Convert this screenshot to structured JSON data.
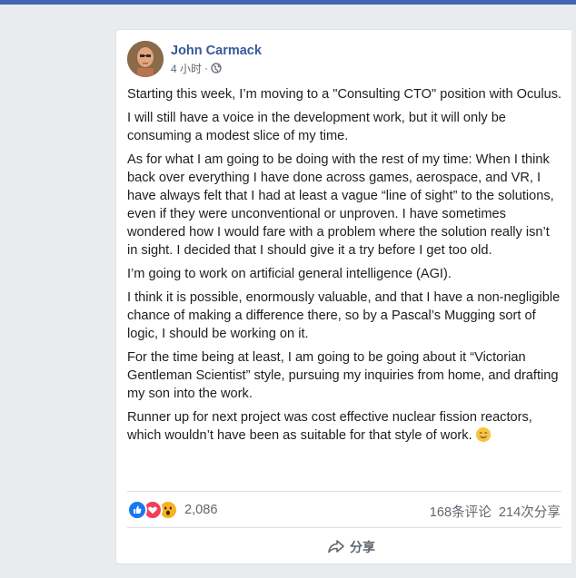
{
  "post": {
    "author": "John Carmack",
    "timestamp": "4 小时",
    "separator": "·",
    "privacy_icon": "globe-icon",
    "paragraphs": [
      "Starting this week, I’m moving to a \"Consulting CTO\" position with Oculus.",
      "I will still have a voice in the development work, but it will only be consuming a modest slice of my time.",
      "As for what I am going to be doing with the rest of my time: When I think back over everything I have done across games, aerospace, and VR, I have always felt that I had at least a vague “line of sight” to the solutions, even if they were unconventional or unproven. I have sometimes wondered how I would fare with a problem where the solution really isn’t in sight. I decided that I should give it a try before I get too old.",
      "I’m going to work on artificial general intelligence (AGI).",
      "I think it is possible, enormously valuable, and that I have a non-negligible chance of making a difference there, so by a Pascal’s Mugging sort of logic, I should be working on it.",
      "For the time being at least, I am going to be going about it “Victorian Gentleman Scientist” style, pursuing my inquiries from home, and drafting my son into the work."
    ],
    "last_paragraph": "Runner up for next project was cost effective nuclear fission reactors, which wouldn’t have been as suitable for that style of work.",
    "last_emoji": "smiling-face-icon"
  },
  "reactions": {
    "icons": [
      "like-icon",
      "love-icon",
      "wow-icon"
    ],
    "count": "2,086"
  },
  "stats": {
    "comments": "168条评论",
    "shares": "214次分享"
  },
  "actions": {
    "share_label": "分享",
    "share_icon": "share-arrow-icon"
  },
  "colors": {
    "background": "#e9ebee",
    "topbar": "#4267b2",
    "author_link": "#385898",
    "text": "#1c1e21",
    "secondary_text": "#606770",
    "like": "#1877f2",
    "love": "#f33e58",
    "wow": "#f7b125"
  }
}
